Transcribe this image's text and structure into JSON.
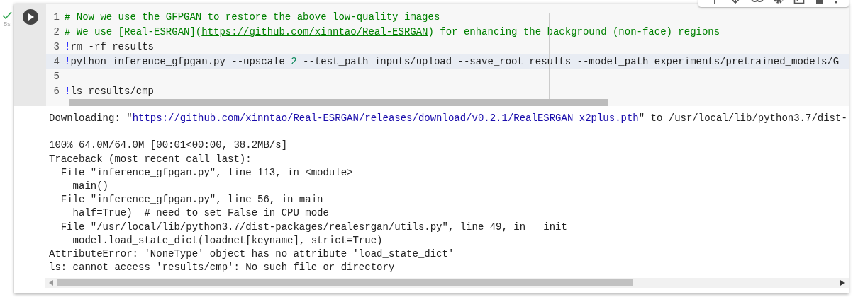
{
  "cell": {
    "run_status": {
      "done": true,
      "duration": "5s"
    },
    "code_lines": [
      {
        "number": "1",
        "highlighted": false,
        "segments": [
          {
            "kind": "comment",
            "text": "# Now we use the GFPGAN to restore the above low-quality images"
          }
        ]
      },
      {
        "number": "2",
        "highlighted": false,
        "segments": [
          {
            "kind": "comment",
            "text": "# We use [Real-ESRGAN]("
          },
          {
            "kind": "comment_link",
            "text": "https://github.com/xinntao/Real-ESRGAN"
          },
          {
            "kind": "comment",
            "text": ") for enhancing the background (non-face) regions"
          }
        ]
      },
      {
        "number": "3",
        "highlighted": false,
        "segments": [
          {
            "kind": "bang",
            "text": "!"
          },
          {
            "kind": "plain",
            "text": "rm -rf results"
          }
        ]
      },
      {
        "number": "4",
        "highlighted": true,
        "segments": [
          {
            "kind": "bang",
            "text": "!"
          },
          {
            "kind": "plain",
            "text": "python inference_gfpgan.py --upscale "
          },
          {
            "kind": "number",
            "text": "2"
          },
          {
            "kind": "plain",
            "text": " --test_path inputs/upload --save_root results --model_path experiments/pretrained_models/G"
          }
        ]
      },
      {
        "number": "5",
        "highlighted": false
      },
      {
        "number": "6",
        "highlighted": false,
        "segments": [
          {
            "kind": "bang",
            "text": "!"
          },
          {
            "kind": "plain",
            "text": "ls results/cmp"
          }
        ]
      }
    ],
    "output_blocks": [
      [
        {
          "segments": [
            {
              "kind": "plain",
              "text": "Downloading: \""
            },
            {
              "kind": "link",
              "text": "https://github.com/xinntao/Real-ESRGAN/releases/download/v0.2.1/RealESRGAN_x2plus.pth"
            },
            {
              "kind": "plain",
              "text": "\" to /usr/local/lib/python3.7/dist-"
            }
          ]
        }
      ],
      [
        {
          "segments": [
            {
              "kind": "plain",
              "text": "100% 64.0M/64.0M [00:01<00:00, 38.2MB/s]"
            }
          ]
        },
        {
          "segments": [
            {
              "kind": "plain",
              "text": "Traceback (most recent call last):"
            }
          ]
        },
        {
          "segments": [
            {
              "kind": "plain",
              "text": "  File \"inference_gfpgan.py\", line 113, in <module>"
            }
          ]
        },
        {
          "segments": [
            {
              "kind": "plain",
              "text": "    main()"
            }
          ]
        },
        {
          "segments": [
            {
              "kind": "plain",
              "text": "  File \"inference_gfpgan.py\", line 56, in main"
            }
          ]
        },
        {
          "segments": [
            {
              "kind": "plain",
              "text": "    half=True)  # need to set False in CPU mode"
            }
          ]
        },
        {
          "segments": [
            {
              "kind": "plain",
              "text": "  File \"/usr/local/lib/python3.7/dist-packages/realesrgan/utils.py\", line 49, in __init__"
            }
          ]
        },
        {
          "segments": [
            {
              "kind": "plain",
              "text": "    model.load_state_dict(loadnet[keyname], strict=True)"
            }
          ]
        },
        {
          "segments": [
            {
              "kind": "plain",
              "text": "AttributeError: 'NoneType' object has no attribute 'load_state_dict'"
            }
          ]
        },
        {
          "segments": [
            {
              "kind": "plain",
              "text": "ls: cannot access 'results/cmp': No such file or directory"
            }
          ]
        }
      ]
    ]
  }
}
